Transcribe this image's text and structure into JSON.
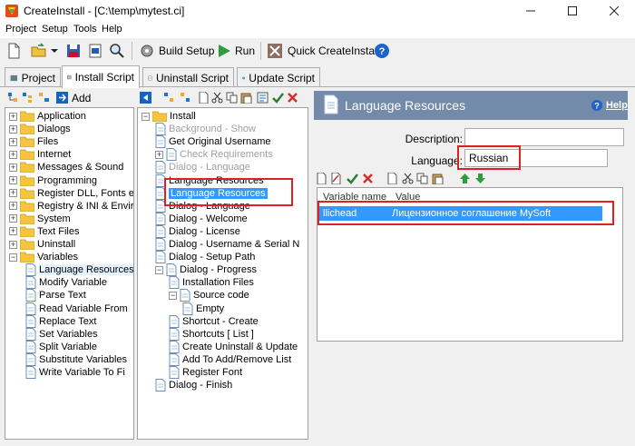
{
  "window": {
    "title": "CreateInstall - [C:\\temp\\mytest.ci]"
  },
  "menu": [
    "Project",
    "Setup",
    "Tools",
    "Help"
  ],
  "toolbar": {
    "build_setup": "Build Setup",
    "run": "Run",
    "quick": "Quick CreateInstall"
  },
  "tabs": [
    "Project",
    "Install Script",
    "Uninstall Script",
    "Update Script"
  ],
  "left_toolbar": {
    "add": "Add"
  },
  "left_tree": [
    {
      "label": "Application",
      "type": "folder",
      "exp": "+"
    },
    {
      "label": "Dialogs",
      "type": "folder",
      "exp": "+"
    },
    {
      "label": "Files",
      "type": "folder",
      "exp": "+"
    },
    {
      "label": "Internet",
      "type": "folder",
      "exp": "+"
    },
    {
      "label": "Messages & Sound",
      "type": "folder",
      "exp": "+"
    },
    {
      "label": "Programming",
      "type": "folder",
      "exp": "+"
    },
    {
      "label": "Register DLL, Fonts etc",
      "type": "folder",
      "exp": "+"
    },
    {
      "label": "Registry & INI & Environ",
      "type": "folder",
      "exp": "+"
    },
    {
      "label": "System",
      "type": "folder",
      "exp": "+"
    },
    {
      "label": "Text Files",
      "type": "folder",
      "exp": "+"
    },
    {
      "label": "Uninstall",
      "type": "folder",
      "exp": "+"
    },
    {
      "label": "Variables",
      "type": "folder",
      "exp": "-"
    },
    {
      "label": "Language Resources",
      "type": "doc",
      "indent": 1,
      "state": "light"
    },
    {
      "label": "Modify Variable",
      "type": "doc",
      "indent": 1
    },
    {
      "label": "Parse Text",
      "type": "doc",
      "indent": 1
    },
    {
      "label": "Read Variable From",
      "type": "doc",
      "indent": 1
    },
    {
      "label": "Replace Text",
      "type": "doc",
      "indent": 1
    },
    {
      "label": "Set Variables",
      "type": "doc",
      "indent": 1
    },
    {
      "label": "Split Variable",
      "type": "doc",
      "indent": 1
    },
    {
      "label": "Substitute Variables",
      "type": "doc",
      "indent": 1
    },
    {
      "label": "Write Variable To Fi",
      "type": "doc",
      "indent": 1
    }
  ],
  "script_tree": [
    {
      "label": "Install",
      "type": "folder",
      "exp": "-",
      "indent": 0
    },
    {
      "label": "Background - Show",
      "type": "doc",
      "indent": 1,
      "state": "grey"
    },
    {
      "label": "Get Original Username",
      "type": "doc",
      "indent": 1
    },
    {
      "label": "Check Requirements",
      "type": "doc",
      "indent": 1,
      "state": "grey",
      "exp": "+"
    },
    {
      "label": "Dialog - Language",
      "type": "doc",
      "indent": 1,
      "state": "grey"
    },
    {
      "label": "Language Resources",
      "type": "doc",
      "indent": 1
    },
    {
      "label": "Language Resources",
      "type": "doc",
      "indent": 1,
      "state": "selected"
    },
    {
      "label": "Dialog - Language",
      "type": "doc",
      "indent": 1
    },
    {
      "label": "Dialog - Welcome",
      "type": "doc",
      "indent": 1
    },
    {
      "label": "Dialog - License",
      "type": "doc",
      "indent": 1
    },
    {
      "label": "Dialog - Username & Serial N",
      "type": "doc",
      "indent": 1
    },
    {
      "label": "Dialog - Setup Path",
      "type": "doc",
      "indent": 1
    },
    {
      "label": "Dialog - Progress",
      "type": "doc",
      "indent": 1,
      "exp": "-"
    },
    {
      "label": "Installation Files",
      "type": "doc",
      "indent": 2
    },
    {
      "label": "Source code",
      "type": "doc",
      "indent": 2,
      "exp": "-"
    },
    {
      "label": "Empty",
      "type": "doc",
      "indent": 3
    },
    {
      "label": "Shortcut - Create",
      "type": "doc",
      "indent": 2
    },
    {
      "label": "Shortcuts [ List ]",
      "type": "doc",
      "indent": 2
    },
    {
      "label": "Create Uninstall & Update",
      "type": "doc",
      "indent": 2
    },
    {
      "label": "Add To Add/Remove List",
      "type": "doc",
      "indent": 2
    },
    {
      "label": "Register Font",
      "type": "doc",
      "indent": 2
    },
    {
      "label": "Dialog - Finish",
      "type": "doc",
      "indent": 1
    }
  ],
  "right": {
    "title": "Language Resources",
    "help": "Help",
    "description_label": "Description:",
    "description_value": "",
    "language_label": "Language:",
    "language_value": "Russian",
    "col_name": "Variable name",
    "col_value": "Value",
    "row_name": "llichead",
    "row_value": "Лицензионное соглашение MySoft"
  }
}
